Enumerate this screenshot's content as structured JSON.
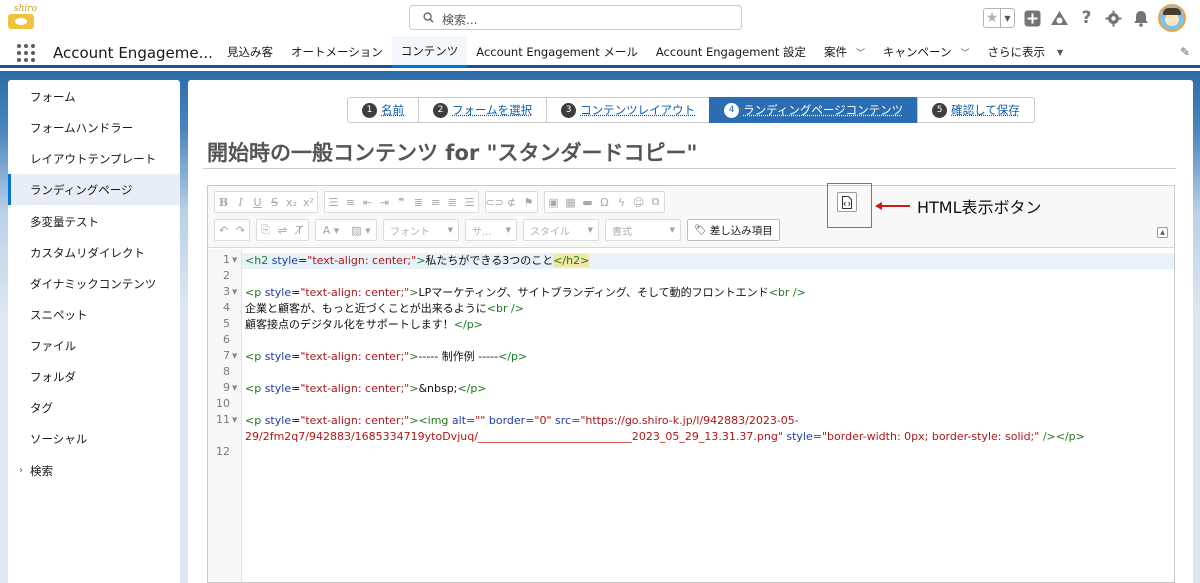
{
  "header": {
    "logo_text": "shiro",
    "search_placeholder": "検索..."
  },
  "nav": {
    "app_name": "Account Engageme...",
    "items": [
      {
        "label": "見込み客",
        "active": false
      },
      {
        "label": "オートメーション",
        "active": false
      },
      {
        "label": "コンテンツ",
        "active": true
      },
      {
        "label": "Account Engagement メール",
        "active": false
      },
      {
        "label": "Account Engagement 設定",
        "active": false
      },
      {
        "label": "案件",
        "active": false,
        "dropdown": true
      },
      {
        "label": "キャンペーン",
        "active": false,
        "dropdown": true
      },
      {
        "label": "さらに表示",
        "active": false,
        "dropdown": true
      }
    ]
  },
  "sidebar": {
    "items": [
      {
        "label": "フォーム"
      },
      {
        "label": "フォームハンドラー"
      },
      {
        "label": "レイアウトテンプレート"
      },
      {
        "label": "ランディングページ",
        "active": true
      },
      {
        "label": "多変量テスト"
      },
      {
        "label": "カスタムリダイレクト"
      },
      {
        "label": "ダイナミックコンテンツ"
      },
      {
        "label": "スニペット"
      },
      {
        "label": "ファイル"
      },
      {
        "label": "フォルダ"
      },
      {
        "label": "タグ"
      },
      {
        "label": "ソーシャル"
      },
      {
        "label": "検索",
        "expandable": true
      }
    ]
  },
  "wizard": {
    "steps": [
      {
        "num": "1",
        "label": "名前"
      },
      {
        "num": "2",
        "label": "フォームを選択"
      },
      {
        "num": "3",
        "label": "コンテンツレイアウト"
      },
      {
        "num": "4",
        "label": "ランディングページコンテンツ",
        "active": true
      },
      {
        "num": "5",
        "label": "確認して保存"
      }
    ]
  },
  "page": {
    "title": "開始時の一般コンテンツ for \"スタンダードコピー\""
  },
  "editor": {
    "toolbar": {
      "font_label": "フォント",
      "size_label": "サ...",
      "style_label": "スタイル",
      "format_label": "書式",
      "merge_label": "差し込み項目"
    },
    "line_numbers": [
      "1",
      "2",
      "3",
      "4",
      "5",
      "6",
      "7",
      "8",
      "9",
      "10",
      "11",
      "",
      "12"
    ],
    "code": {
      "l1_open": "<h2 ",
      "l1_attr": "style",
      "l1_eq": "=",
      "l1_val": "\"text-align: center;\"",
      "l1_gt": ">",
      "l1_text": "私たちができる3つのこと",
      "l1_close": "</h2>",
      "l3_open": "<p ",
      "l3_attr": "style",
      "l3_eq": "=",
      "l3_val": "\"text-align: center;\"",
      "l3_gt": ">",
      "l3_text": "LPマーケティング、サイトブランディング、そして動的フロントエンド",
      "l3_br": "<br />",
      "l4_text": "企業と顧客が、もっと近づくことが出来るように",
      "l4_br": "<br />",
      "l5_text": "顧客接点のデジタル化をサポートします！",
      "l5_close": "</p>",
      "l7_open": "<p ",
      "l7_attr": "style",
      "l7_eq": "=",
      "l7_val": "\"text-align: center;\"",
      "l7_gt": ">",
      "l7_text": "----- 制作例 -----",
      "l7_close": "</p>",
      "l9_open": "<p ",
      "l9_attr": "style",
      "l9_eq": "=",
      "l9_val": "\"text-align: center;\"",
      "l9_gt": ">",
      "l9_text": "&nbsp;",
      "l9_close": "</p>",
      "l11_open": "<p ",
      "l11_attr": "style",
      "l11_eq": "=",
      "l11_val": "\"text-align: center;\"",
      "l11_gt": ">",
      "l11_img": "<img ",
      "l11_alt": "alt",
      "l11_alt_val": "=\"\" ",
      "l11_border": "border",
      "l11_border_val": "=\"0\" ",
      "l11_src": "src",
      "l11_src_val": "=\"https://go.shiro-k.jp/l/942883/2023-05-",
      "l11b_src_val": "29/2fm2q7/942883/1685334719ytoDvjuq/____________________________2023_05_29_13.31.37.png\" ",
      "l11b_style": "style",
      "l11b_style_val": "=\"border-width: 0px; border-style: solid;\" ",
      "l11b_end": "/></p>"
    }
  },
  "annotation": {
    "label": "HTML表示ボタン",
    "color": "#d11a1a"
  }
}
